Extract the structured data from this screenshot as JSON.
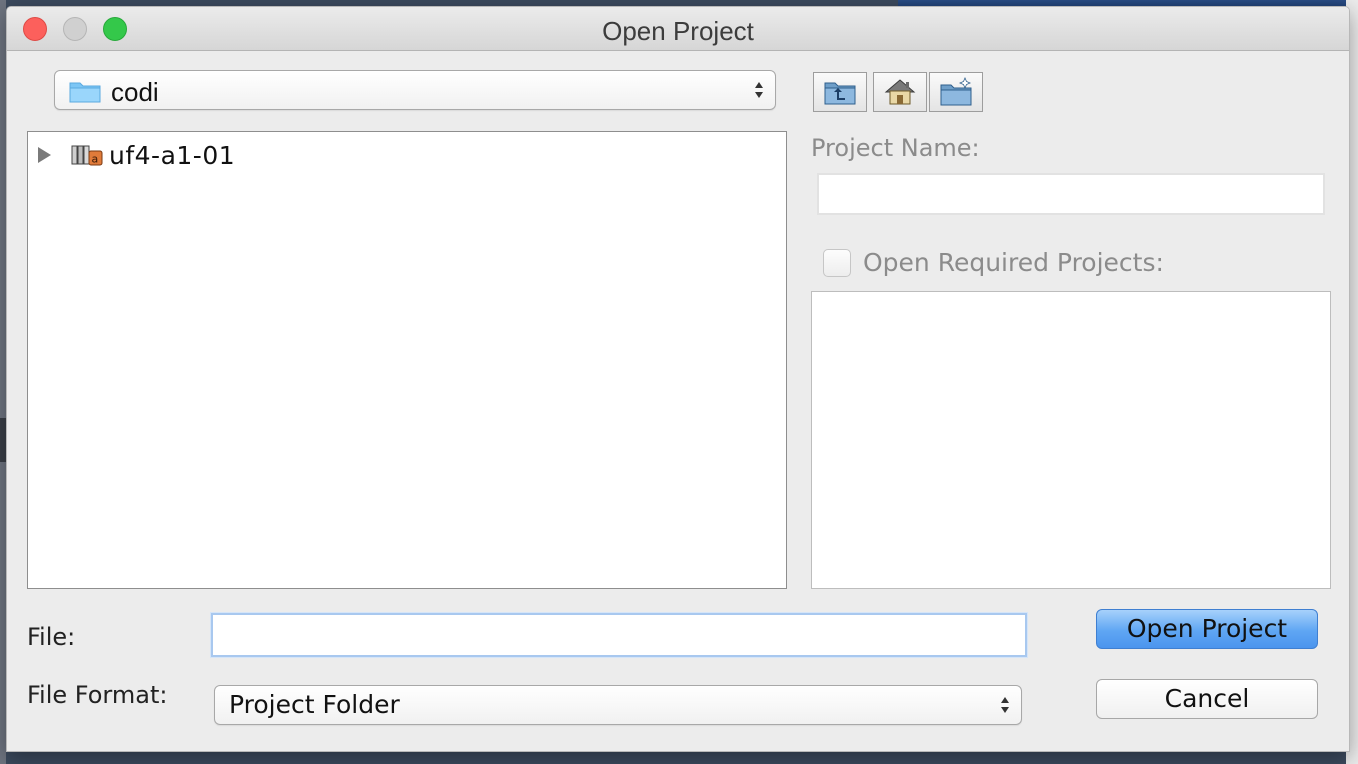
{
  "window": {
    "title": "Open Project"
  },
  "folder_combo": {
    "selected": "codi",
    "icon": "folder-icon"
  },
  "nav_buttons": [
    {
      "name": "up-one-level",
      "icon": "folder-up-icon"
    },
    {
      "name": "home",
      "icon": "home-icon"
    },
    {
      "name": "new-folder",
      "icon": "new-folder-icon"
    }
  ],
  "tree": {
    "items": [
      {
        "label": "uf4-a1-01",
        "icon": "project-icon",
        "expanded": false
      }
    ]
  },
  "project_panel": {
    "name_label": "Project Name:",
    "name_value": "",
    "required_label": "Open Required Projects:",
    "required_checked": false
  },
  "file": {
    "label": "File:",
    "value": ""
  },
  "file_format": {
    "label": "File Format:",
    "selected": "Project Folder"
  },
  "actions": {
    "open_label": "Open Project",
    "cancel_label": "Cancel"
  },
  "colors": {
    "primary_button": "#5fa6f3",
    "close": "#fc605c",
    "maximize": "#34c84a"
  }
}
